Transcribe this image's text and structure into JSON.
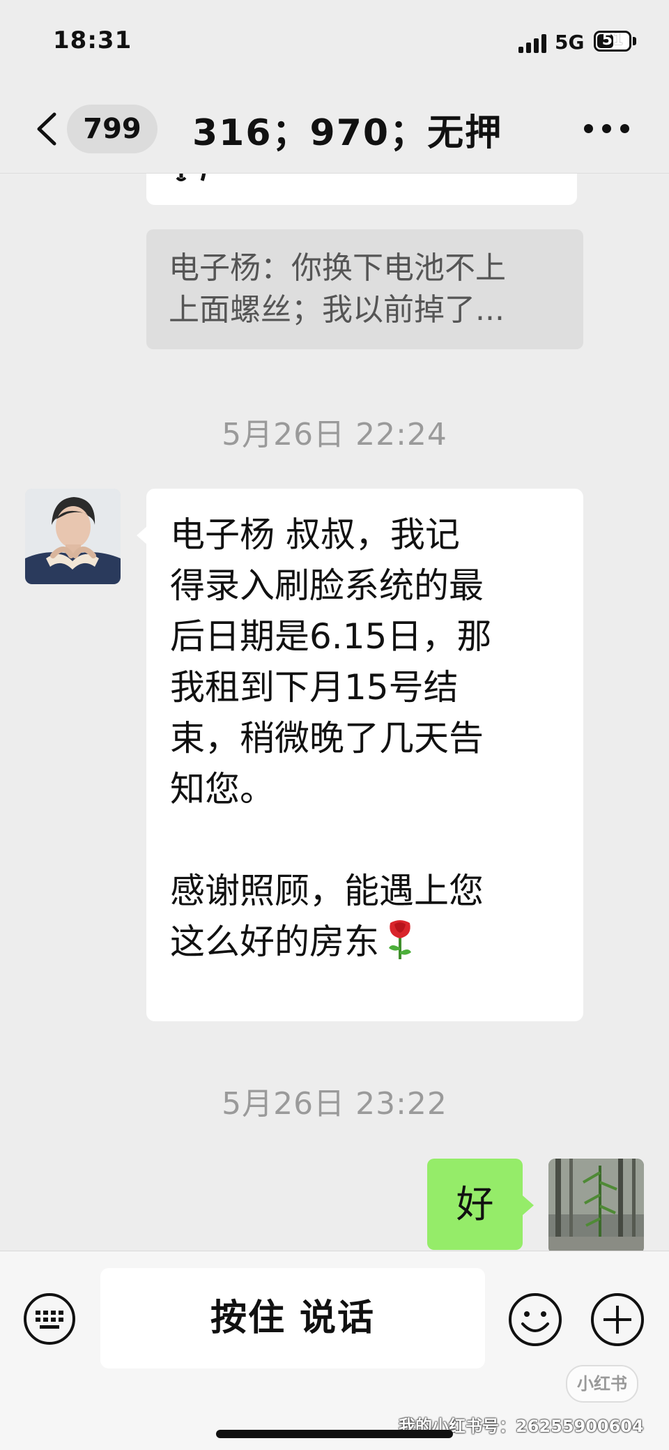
{
  "status_bar": {
    "time": "18:31",
    "network": "5G",
    "battery": "51"
  },
  "header": {
    "unread_count": "799",
    "title": "316；970；无押"
  },
  "chat": {
    "quote_lines": [
      "电子杨：你换下电池不上",
      "上面螺丝；我以前掉了..."
    ],
    "timestamp_1": "5月26日 22:24",
    "message_lines": [
      "电子杨 叔叔，我记",
      "得录入刷脸系统的最",
      "后日期是6.15日，那",
      "我租到下月15号结",
      "束，稍微晚了几天告",
      "知您。",
      "",
      "感谢照顾，能遇上您",
      "这么好的房东"
    ],
    "timestamp_2": "5月26日 23:22",
    "reply": "好"
  },
  "input_bar": {
    "hold_to_talk": "按住 说话"
  },
  "watermark": {
    "logo": "小红书",
    "id_text": "我的小红书号：2625590060​4"
  },
  "colors": {
    "background": "#ededed",
    "reply_bubble": "#95ec69",
    "bubble": "#ffffff"
  },
  "icons": [
    "back-icon",
    "more-icon",
    "keyboard-icon",
    "emoji-icon",
    "plus-icon",
    "rose-icon"
  ]
}
